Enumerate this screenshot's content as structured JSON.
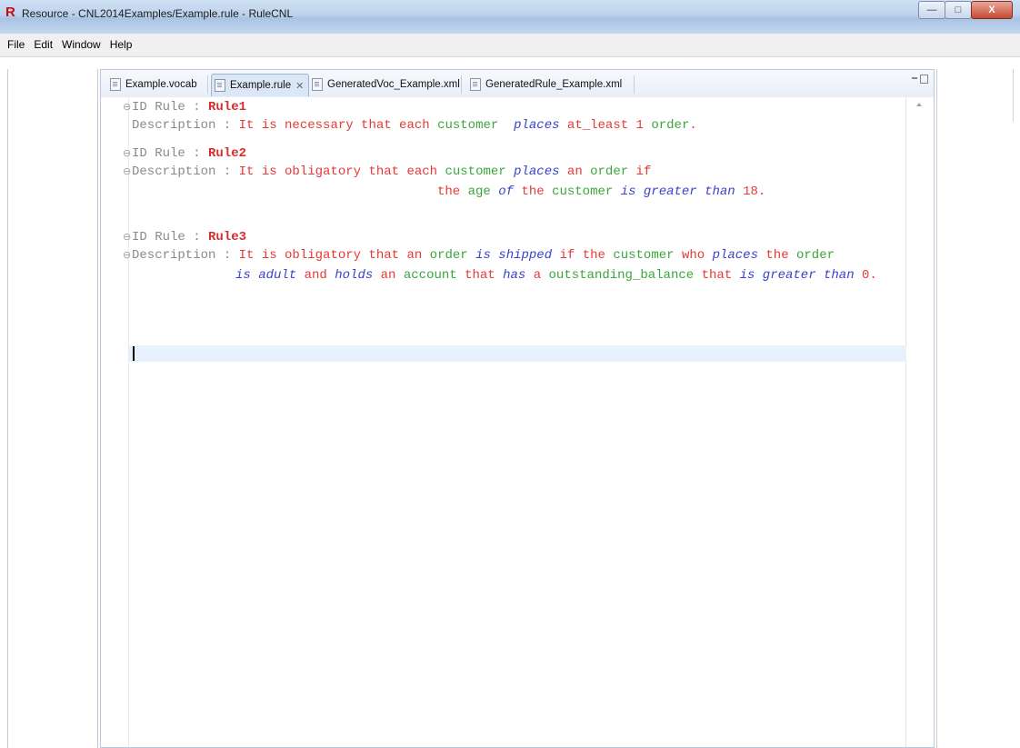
{
  "window": {
    "title": "Resource - CNL2014Examples/Example.rule - RuleCNL",
    "logo": "R",
    "controls": {
      "minimize": "—",
      "maximize": "□",
      "close": "X"
    }
  },
  "menu": [
    "File",
    "Edit",
    "Window",
    "Help"
  ],
  "tabs": [
    {
      "label": "Example.vocab",
      "active": false
    },
    {
      "label": "Example.rule",
      "active": true,
      "close": "✕"
    },
    {
      "label": "GeneratedVoc_Example.xml",
      "active": false
    },
    {
      "label": "GeneratedRule_Example.xml",
      "active": false
    }
  ],
  "editor": {
    "rule1": {
      "id_key": "ID Rule : ",
      "id_val": "Rule1",
      "desc_key": "Description : ",
      "t1": "It is necessary that each ",
      "t2": "customer",
      "t3": " ",
      "t4": "places",
      "t5": " at_least 1 ",
      "t6": "order",
      "t7": "."
    },
    "rule2": {
      "id_key": "ID Rule : ",
      "id_val": "Rule2",
      "desc_key": "Description : ",
      "a1": "It is obligatory that each ",
      "a2": "customer",
      "a3": "places",
      "a4": " an ",
      "a5": "order",
      "a6": " if",
      "b1": "the ",
      "b2": "age",
      "b3": "of",
      "b4": " the ",
      "b5": "customer",
      "b6": "is greater than",
      "b7": " 18."
    },
    "rule3": {
      "id_key": "ID Rule : ",
      "id_val": "Rule3",
      "desc_key": "Description : ",
      "a1": "It is obligatory that an ",
      "a2": "order",
      "a3": "is shipped",
      "a4": " if the ",
      "a5": "customer",
      "a6": " who ",
      "a7": "places",
      "a8": " the ",
      "a9": "order",
      "b1": "is adult",
      "b2": " and ",
      "b3": "holds",
      "b4": " an ",
      "b5": "account",
      "b6": " that ",
      "b7": "has",
      "b8": " a ",
      "b9": "outstanding_balance",
      "b10": " that ",
      "b11": "is greater than",
      "b12": " 0."
    }
  },
  "colors": {
    "keyword": "#8a8a8a",
    "rule_id": "#d32f2f",
    "text": "#e53935",
    "concept": "#3aa63a",
    "verb": "#3a43c9",
    "current_line": "#e8f2fe"
  }
}
